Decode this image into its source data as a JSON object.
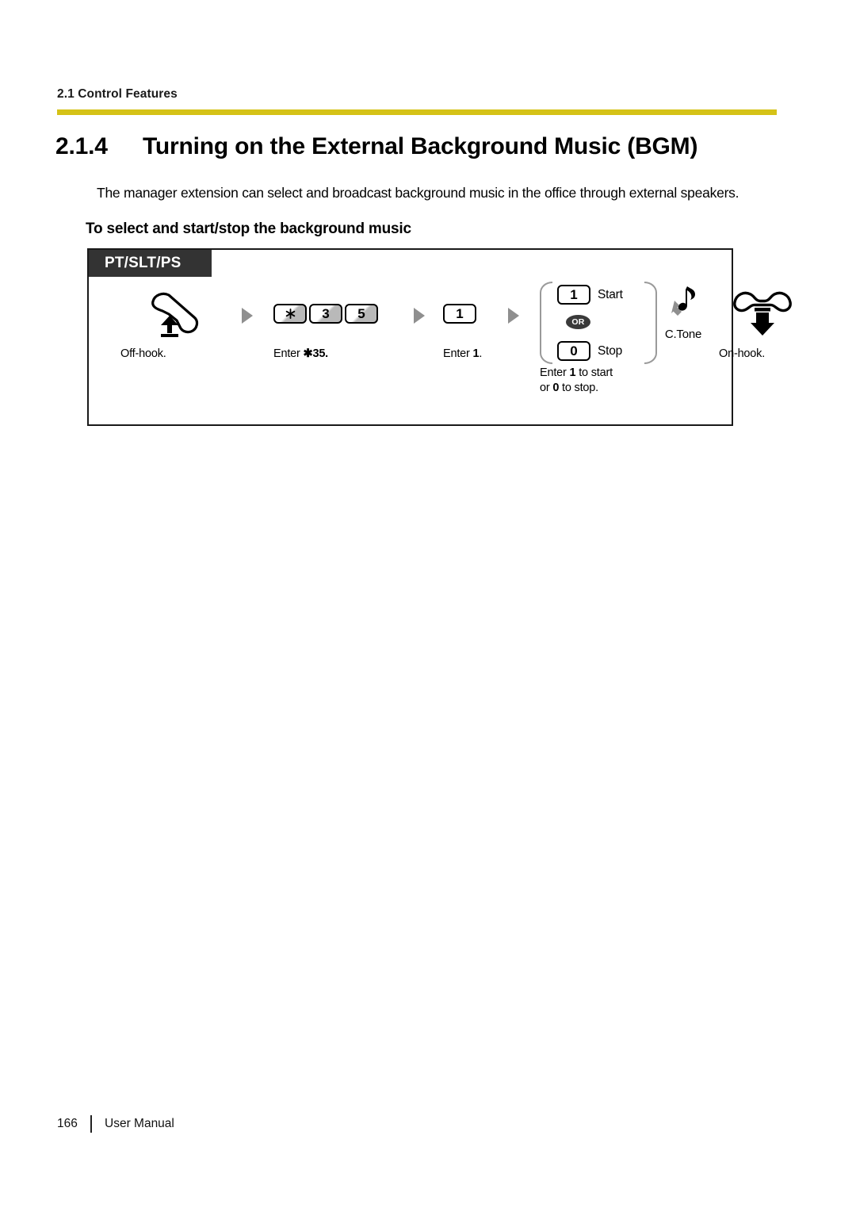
{
  "header": {
    "running_head": "2.1 Control Features",
    "rule_color": "#d5c217"
  },
  "section": {
    "number": "2.1.4",
    "title": "Turning on the External Background Music (BGM)"
  },
  "intro": "The manager extension can select and broadcast background music in the office through external speakers.",
  "sub_heading": "To select and start/stop the background music",
  "procedure": {
    "tab_label": "PT/SLT/PS",
    "steps": [
      {
        "id": "off-hook",
        "icon": "handset-off-hook-icon",
        "caption_plain": "Off-hook."
      },
      {
        "id": "enter-star-35",
        "keys": [
          "✳",
          "3",
          "5"
        ],
        "caption_prefix": "Enter ",
        "caption_bold": "✱35.",
        "caption_plain": "Enter ✱35."
      },
      {
        "id": "enter-1",
        "keys": [
          "1"
        ],
        "caption_prefix": "Enter ",
        "caption_bold": "1",
        "caption_suffix": ".",
        "caption_plain": "Enter 1."
      },
      {
        "id": "start-stop",
        "or_label": "OR",
        "start_key": "1",
        "start_label": "Start",
        "stop_key": "0",
        "stop_label": "Stop",
        "caption_line1_a": "Enter ",
        "caption_line1_b": "1",
        "caption_line1_c": " to start",
        "caption_line2_a": "or ",
        "caption_line2_b": "0",
        "caption_line2_c": " to stop.",
        "caption_plain": "Enter 1 to start or 0 to stop."
      },
      {
        "id": "confirmation-tone",
        "icon": "music-note-icon",
        "label": "C.Tone"
      },
      {
        "id": "on-hook",
        "icon": "handset-on-hook-icon",
        "caption_plain": "On-hook."
      }
    ]
  },
  "footer": {
    "page_number": "166",
    "doc_title": "User Manual"
  }
}
